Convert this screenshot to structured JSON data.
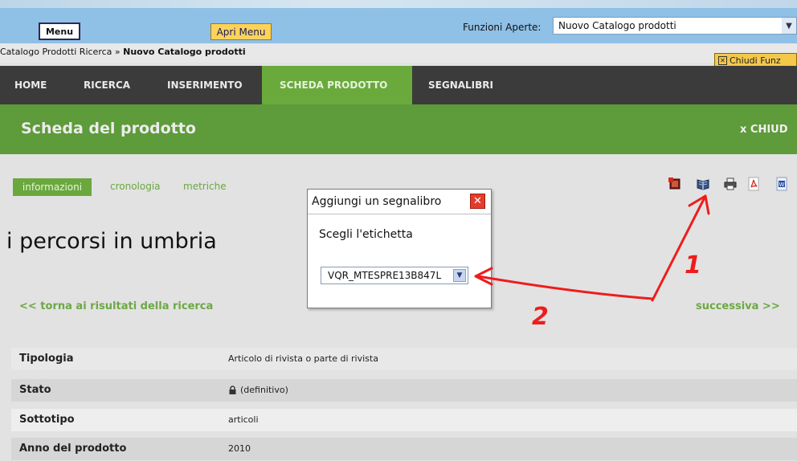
{
  "topbar": {
    "menu_label": "Menu",
    "apri_menu_label": "Apri Menu",
    "funzioni_label": "Funzioni Aperte:",
    "funzioni_selected": "Nuovo Catalogo prodotti"
  },
  "breadcrumb": {
    "parent": "Catalogo Prodotti Ricerca",
    "separator": " » ",
    "current": "Nuovo Catalogo prodotti"
  },
  "chiudi_funz_label": "Chiudi Funz",
  "nav": {
    "items": [
      "HOME",
      "RICERCA",
      "INSERIMENTO",
      "SCHEDA PRODOTTO",
      "SEGNALIBRI"
    ],
    "active_index": 3
  },
  "header": {
    "title": "Scheda del prodotto",
    "close_label": "x CHIUD"
  },
  "tabs": [
    "informazioni",
    "cronologia",
    "metriche"
  ],
  "toolbar_icons": [
    "bookmark-remove-icon",
    "book-icon",
    "print-icon",
    "pdf-icon",
    "word-icon"
  ],
  "product": {
    "title": "i percorsi in umbria",
    "back_link": "<< torna ai risultati della ricerca",
    "next_link": "successiva >>"
  },
  "details": [
    {
      "label": "Tipologia",
      "value": "Articolo di rivista o parte di rivista"
    },
    {
      "label": "Stato",
      "value": "(definitivo)",
      "icon": "lock-icon"
    },
    {
      "label": "Sottotipo",
      "value": "articoli"
    },
    {
      "label": "Anno del prodotto",
      "value": "2010"
    }
  ],
  "dialog": {
    "title": "Aggiungi un segnalibro",
    "label": "Scegli l'etichetta",
    "selected": "VQR_MTESPRE13B847L"
  },
  "annotations": {
    "number_1": "1",
    "number_2": "2",
    "arrow_color": "#ee1c1c"
  },
  "colors": {
    "green": "#6aa83e",
    "nav_bg": "#3b3b3b",
    "title_band": "#5e9b3a",
    "row_light": "#f0f0f0",
    "row_shaded": "#d6d6d6"
  }
}
